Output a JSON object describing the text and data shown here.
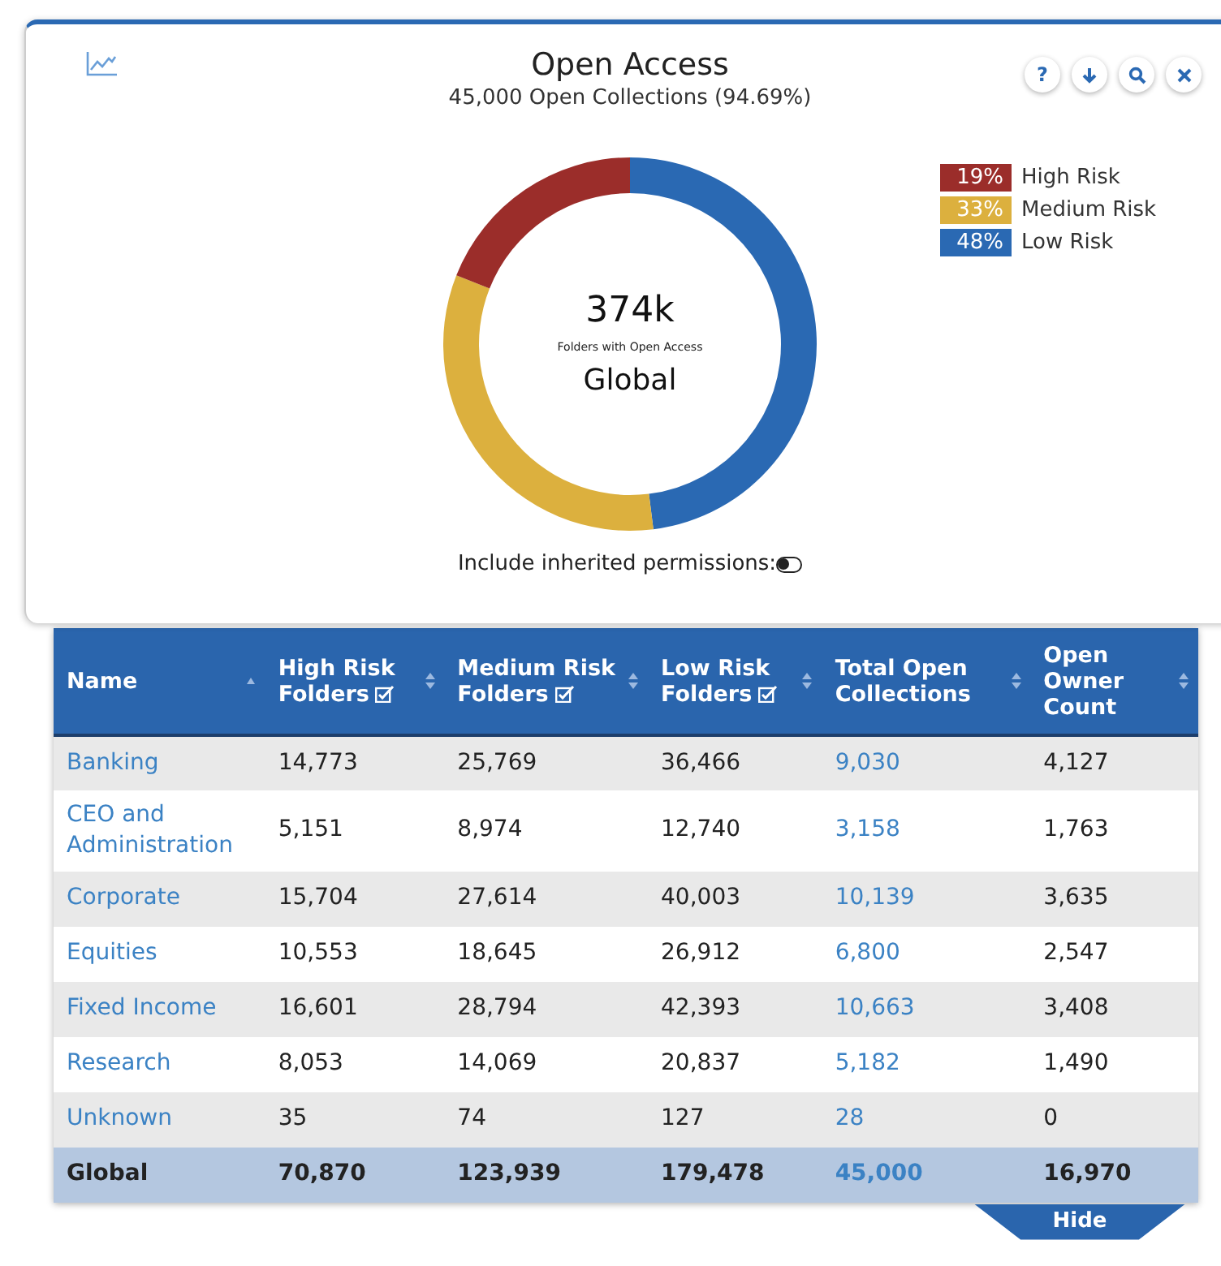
{
  "card": {
    "title": "Open Access",
    "subtitle": "45,000 Open Collections (94.69%)",
    "actions": [
      {
        "kind": "help",
        "label": "?"
      },
      {
        "kind": "download"
      },
      {
        "kind": "search"
      },
      {
        "kind": "close"
      }
    ],
    "center": {
      "value": "374k",
      "caption": "Folders with Open Access",
      "scope": "Global"
    },
    "legend": [
      {
        "pct": "19%",
        "color": "#9b2d2a"
      },
      {
        "pct": "33%",
        "color": "#dcb03e"
      },
      {
        "pct": "48%",
        "color": "#2a69b3"
      }
    ],
    "chart_data": {
      "type": "donut",
      "categories": [
        "High Risk",
        "Medium Risk",
        "Low Risk"
      ],
      "values": [
        19,
        33,
        48
      ]
    },
    "toggle": {
      "label": "Include inherited permissions:",
      "on": false
    }
  },
  "table": {
    "columns": [
      {
        "label": "Name",
        "sorted": true,
        "checkbox": false
      },
      {
        "label": "High Risk Folders",
        "sorted": false,
        "checkbox": true
      },
      {
        "label": "Medium Risk Folders",
        "sorted": false,
        "checkbox": true
      },
      {
        "label": "Low Risk Folders",
        "sorted": false,
        "checkbox": true
      },
      {
        "label": "Total Open Collections",
        "sorted": false,
        "checkbox": false
      },
      {
        "label": "Open Owner Count",
        "sorted": false,
        "checkbox": false
      }
    ],
    "rows": [
      [
        "Banking",
        "14,773",
        "25,769",
        "36,466",
        "9,030",
        "4,127"
      ],
      [
        "CEO and Administration",
        "5,151",
        "8,974",
        "12,740",
        "3,158",
        "1,763"
      ],
      [
        "Corporate",
        "15,704",
        "27,614",
        "40,003",
        "10,139",
        "3,635"
      ],
      [
        "Equities",
        "10,553",
        "18,645",
        "26,912",
        "6,800",
        "2,547"
      ],
      [
        "Fixed Income",
        "16,601",
        "28,794",
        "42,393",
        "10,663",
        "3,408"
      ],
      [
        "Research",
        "8,053",
        "14,069",
        "20,837",
        "5,182",
        "1,490"
      ],
      [
        "Unknown",
        "35",
        "74",
        "127",
        "28",
        "0"
      ]
    ],
    "total": [
      "Global",
      "70,870",
      "123,939",
      "179,478",
      "45,000",
      "16,970"
    ]
  },
  "hide_tab": "Hide"
}
